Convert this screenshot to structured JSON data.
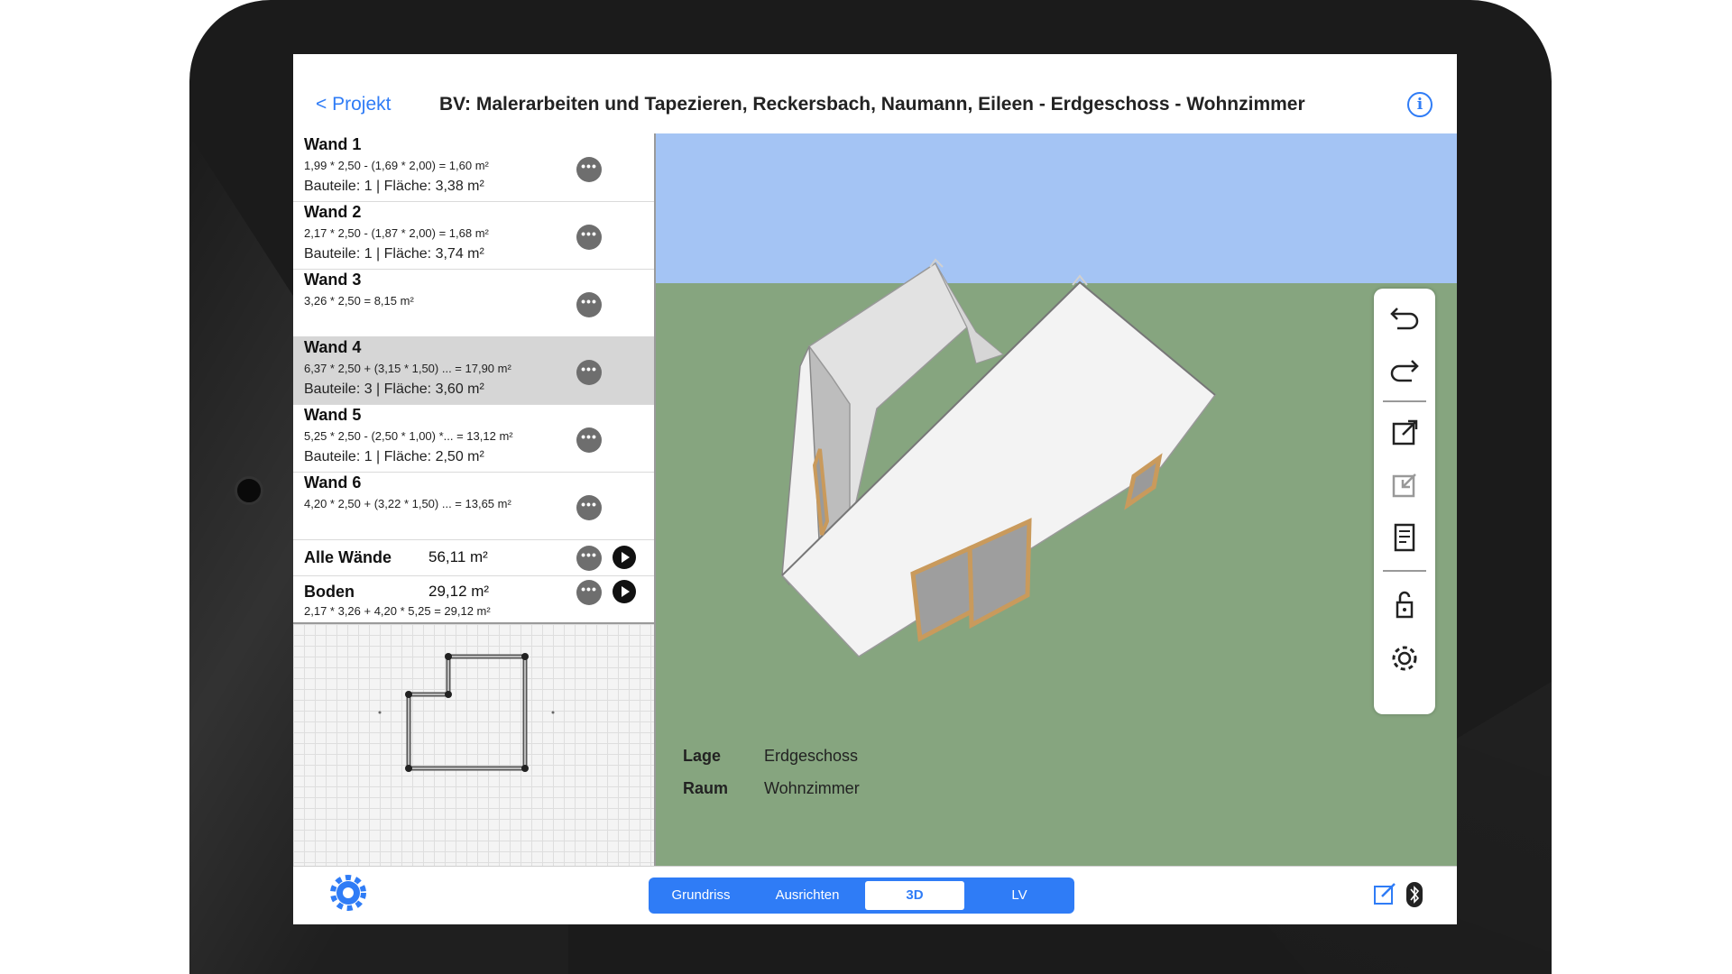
{
  "nav": {
    "back_label": "< Projekt",
    "title": "BV: Malerarbeiten und Tapezieren, Reckersbach, Naumann, Eileen - Erdgeschoss - Wohnzimmer",
    "info_icon": "info-icon"
  },
  "walls": [
    {
      "title": "Wand 1",
      "formula": "1,99 * 2,50  - (1,69 * 2,00)   = 1,60 m²",
      "parts": "Bauteile: 1 | Fläche: 3,38 m²"
    },
    {
      "title": "Wand 2",
      "formula": "2,17 * 2,50  - (1,87 * 2,00)   = 1,68 m²",
      "parts": "Bauteile: 1 | Fläche: 3,74 m²"
    },
    {
      "title": "Wand 3",
      "formula": "3,26 * 2,50   = 8,15 m²",
      "parts": ""
    },
    {
      "title": "Wand 4",
      "formula": "6,37 * 2,50   + (3,15 * 1,50) ... = 17,90 m²",
      "parts": "Bauteile: 3 | Fläche: 3,60 m²"
    },
    {
      "title": "Wand 5",
      "formula": "5,25 * 2,50  - (2,50 * 1,00) *... = 13,12 m²",
      "parts": "Bauteile: 1 | Fläche: 2,50 m²"
    },
    {
      "title": "Wand 6",
      "formula": "4,20 * 2,50   + (3,22 * 1,50) ... = 13,65 m²",
      "parts": ""
    }
  ],
  "summary": {
    "all_walls_label": "Alle Wände",
    "all_walls_value": "56,11 m²",
    "floor_label": "Boden",
    "floor_value": "29,12 m²",
    "floor_formula": "2,17 * 3,26   + 4,20 * 5,25   = 29,12 m²"
  },
  "room_info": {
    "lage_label": "Lage",
    "lage_value": "Erdgeschoss",
    "raum_label": "Raum",
    "raum_value": "Wohnzimmer"
  },
  "toolbar_icons": [
    "undo-icon",
    "redo-icon",
    "export-icon",
    "import-icon",
    "document-icon",
    "lock-icon",
    "gear-icon"
  ],
  "tabs": [
    "Grundriss",
    "Ausrichten",
    "3D",
    "LV"
  ],
  "active_tab": "3D",
  "colors": {
    "accent": "#2f7cf6",
    "sky": "#a4c4f4",
    "ground": "#86a57f",
    "selected_row": "#d6d6d6"
  }
}
